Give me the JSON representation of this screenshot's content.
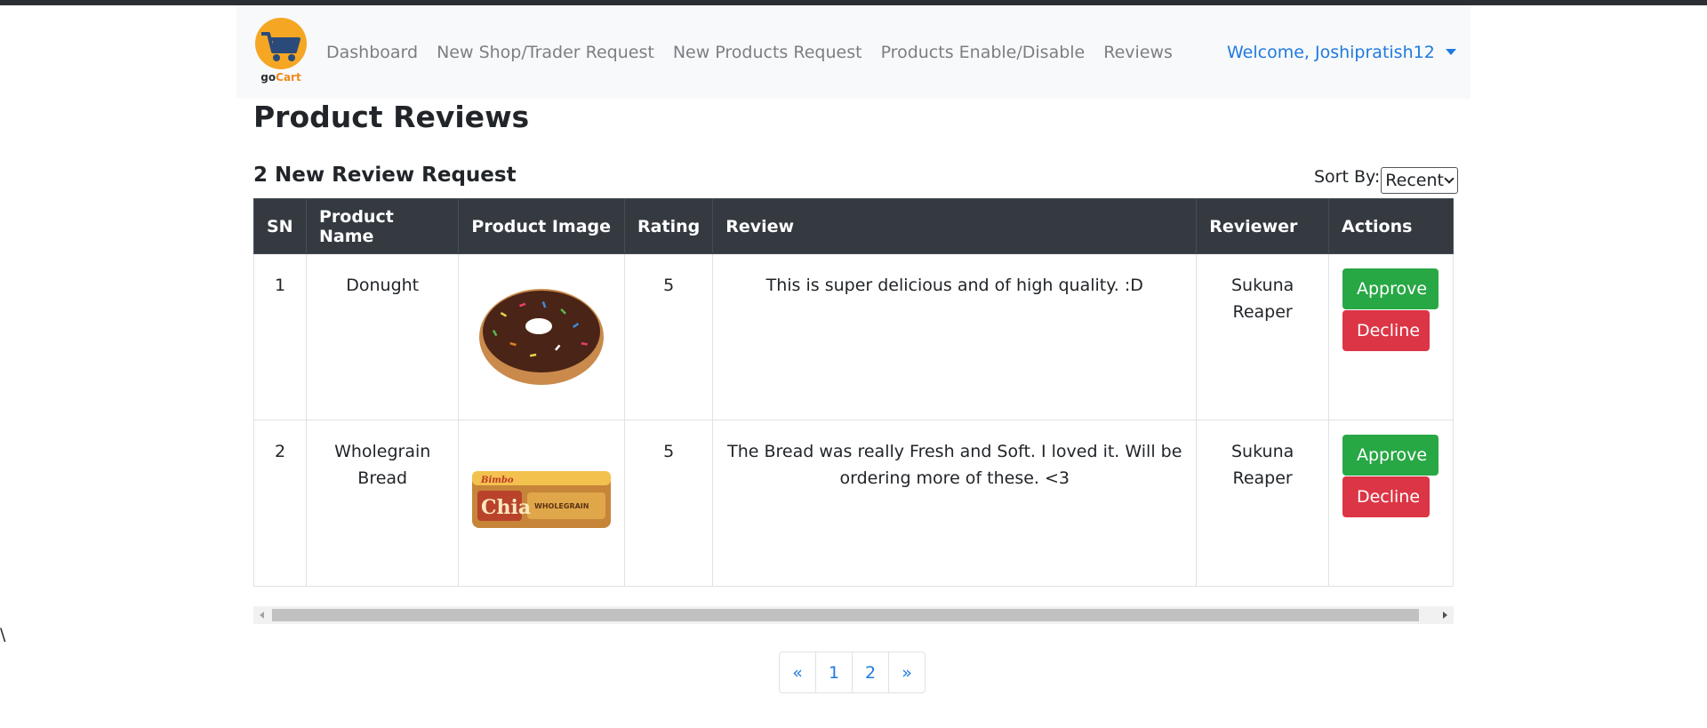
{
  "nav": {
    "brand": "goCart",
    "brand_go": "go",
    "brand_cart": "Cart",
    "links": [
      "Dashboard",
      "New Shop/Trader Request",
      "New Products Request",
      "Products Enable/Disable",
      "Reviews"
    ],
    "welcome": "Welcome, Joshipratish12"
  },
  "page": {
    "title": "Product Reviews",
    "subtitle": "2 New Review Request",
    "sort_label": "Sort By:",
    "sort_value": "Recent"
  },
  "table": {
    "headers": [
      "SN",
      "Product Name",
      "Product Image",
      "Rating",
      "Review",
      "Reviewer",
      "Actions"
    ],
    "rows": [
      {
        "sn": "1",
        "name": "Donught",
        "image": "donut-image",
        "rating": "5",
        "review": "This is super delicious and of high quality. :D",
        "reviewer": "Sukuna Reaper",
        "approve": "Approve",
        "decline": "Decline"
      },
      {
        "sn": "2",
        "name": "Wholegrain Bread",
        "image": "bread-image",
        "rating": "5",
        "review": "The Bread was really Fresh and Soft. I loved it. Will be ordering more of these. <3",
        "reviewer": "Sukuna Reaper",
        "approve": "Approve",
        "decline": "Decline",
        "package_brand": "Bimbo",
        "package_label": "Chia",
        "package_sub": "WHOLEGRAIN"
      }
    ]
  },
  "stray_text": "\\",
  "pagination": [
    "«",
    "1",
    "2",
    "»"
  ],
  "colors": {
    "primary": "#1f7ae0",
    "success": "#28a745",
    "danger": "#dc3545",
    "header_dark": "#343a40",
    "logo_orange": "#f5a623"
  }
}
